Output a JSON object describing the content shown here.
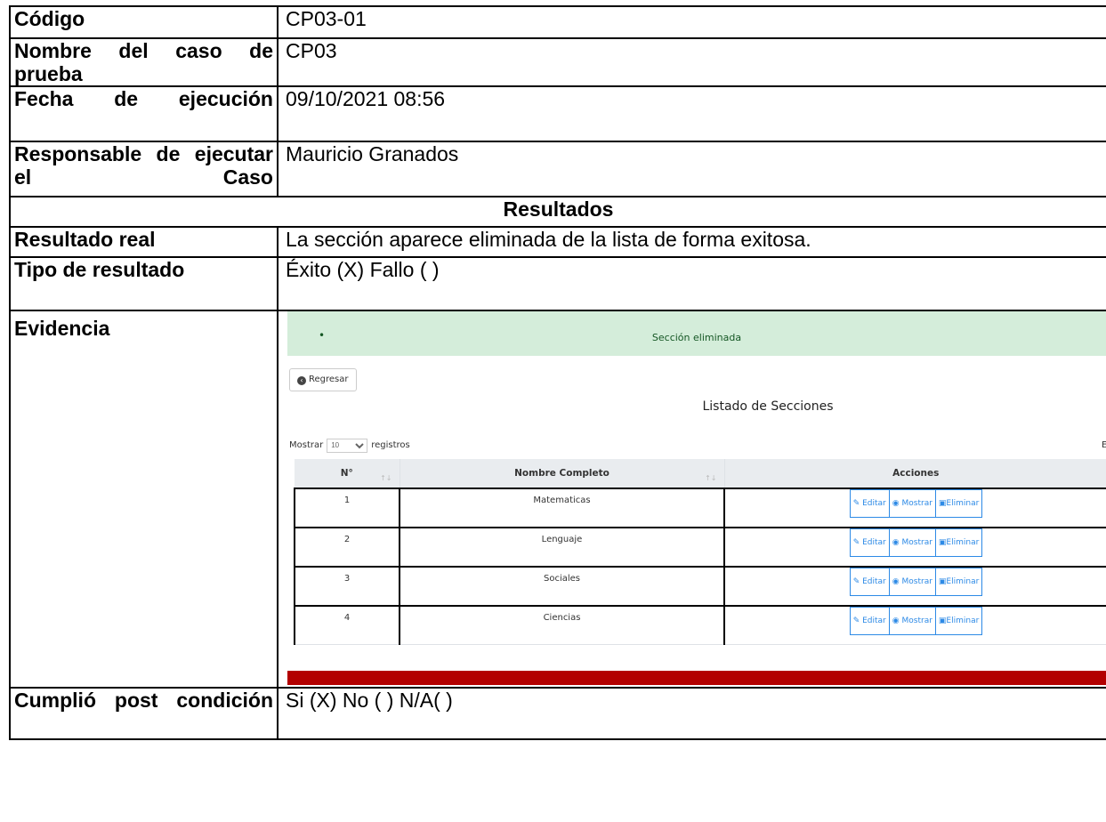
{
  "rows": {
    "codigo": {
      "label": "Código",
      "value": "CP03-01"
    },
    "nombre": {
      "label": "Nombre del caso de prueba",
      "value": "CP03"
    },
    "fecha": {
      "label": "Fecha de ejecución",
      "value": "09/10/2021 08:56"
    },
    "responsable": {
      "label": "Responsable de ejecutar el Caso",
      "value": "Mauricio Granados"
    },
    "resultados_header": "Resultados",
    "resultado_real": {
      "label": "Resultado real",
      "value": "La sección aparece eliminada de la lista de forma exitosa."
    },
    "tipo": {
      "label": "Tipo de resultado",
      "value": "Éxito (X) Fallo ( )"
    },
    "evidencia": {
      "label": "Evidencia"
    },
    "cumplio": {
      "label": "Cumplió post condición",
      "value": "Si (X) No ( ) N/A( )"
    }
  },
  "screenshot": {
    "alert_bullet": "•",
    "alert_message": "Sección eliminada",
    "back_button": "Regresar",
    "back_icon": "circle-arrow-left-icon",
    "title": "Listado de Secciones",
    "length_prefix": "Mostrar",
    "length_value": "10",
    "length_suffix": "registros",
    "cut_text": "E",
    "columns": [
      "N°",
      "Nombre Completo",
      "Acciones"
    ],
    "sort_glyph": "↑↓",
    "rows": [
      {
        "n": "1",
        "name": "Matematicas"
      },
      {
        "n": "2",
        "name": "Lenguaje"
      },
      {
        "n": "3",
        "name": "Sociales"
      },
      {
        "n": "4",
        "name": "Ciencias"
      }
    ],
    "actions": {
      "edit": "Editar",
      "show": "Mostrar",
      "delete": "Eliminar"
    },
    "colors": {
      "alert_bg": "#d4edda",
      "alert_text": "#155724",
      "action_blue": "#2d8ae6",
      "bottom_bar": "#b30000"
    }
  }
}
